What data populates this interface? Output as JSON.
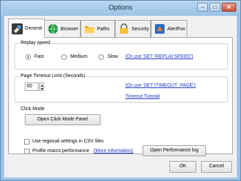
{
  "window": {
    "title": "Options",
    "controls": {
      "minimize": "–",
      "maximize": "□",
      "close": "✕"
    }
  },
  "tabs": [
    {
      "label": "General",
      "icon": "tools-icon",
      "active": true
    },
    {
      "label": "Browser",
      "icon": "globe-icon",
      "active": false
    },
    {
      "label": "Paths",
      "icon": "folder-icon",
      "active": false
    },
    {
      "label": "Security",
      "icon": "lock-icon",
      "active": false
    },
    {
      "label": "AlertFox",
      "icon": "alertfox-icon",
      "active": false
    }
  ],
  "replay": {
    "title": "Replay speed",
    "options": [
      "Fast",
      "Medium",
      "Slow"
    ],
    "selected": "Fast",
    "link": "(Or use 'SET !REPLAYSPEED')"
  },
  "timeout": {
    "title": "Page Timeout Limit (Seconds)",
    "value": "60",
    "link": "(Or use 'SET !TIMEOUT_PAGE')",
    "tutorial": "Timeout Tutorial"
  },
  "click_mode": {
    "title": "Click Mode",
    "button": "Open Click Mode Panel"
  },
  "options": {
    "regional_label": "Use regional settings in CSV files",
    "profile_label": "Profile macro performance",
    "more_info": "(More Information)",
    "performance_button": "Open Performance log"
  },
  "footer": {
    "ok": "OK",
    "cancel": "Cancel"
  },
  "colors": {
    "frame": "#9cc3e6",
    "link": "#1a34c9",
    "close": "#c9503a"
  }
}
